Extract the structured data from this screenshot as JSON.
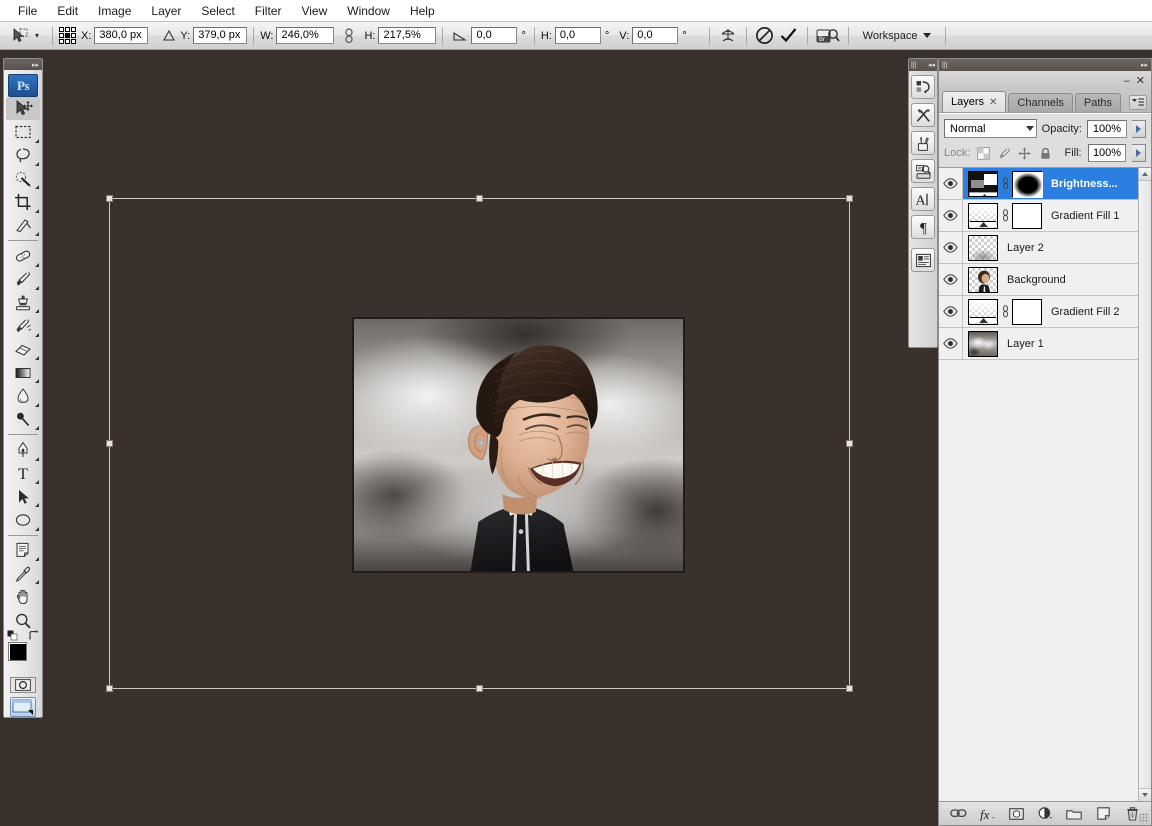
{
  "app": {
    "title": "Adobe Photoshop",
    "logo_text": "Ps"
  },
  "menubar": {
    "items": [
      {
        "label": "File"
      },
      {
        "label": "Edit"
      },
      {
        "label": "Image"
      },
      {
        "label": "Layer"
      },
      {
        "label": "Select"
      },
      {
        "label": "Filter"
      },
      {
        "label": "View"
      },
      {
        "label": "Window"
      },
      {
        "label": "Help"
      }
    ]
  },
  "options_bar": {
    "active_tool": "move-tool",
    "reference_point_label": "reference-point-grid",
    "fields": [
      {
        "name": "x",
        "label": "X:",
        "value": "380,0 px"
      },
      {
        "name": "y",
        "label": "Y:",
        "value": "379,0 px"
      },
      {
        "name": "width",
        "label": "W:",
        "value": "246,0%"
      },
      {
        "name": "height",
        "label": "H:",
        "value": "217,5%"
      },
      {
        "name": "rotate",
        "label": "",
        "value": "0,0",
        "unit": "°"
      },
      {
        "name": "skew_h",
        "label": "H:",
        "value": "0,0",
        "unit": "°"
      },
      {
        "name": "skew_v",
        "label": "V:",
        "value": "0,0",
        "unit": "°"
      }
    ],
    "link_tooltip": "Maintain aspect ratio",
    "buttons": [
      {
        "name": "warp-mode-button",
        "icon": "warp-icon"
      },
      {
        "name": "cancel-transform-button",
        "icon": "cancel-icon"
      },
      {
        "name": "commit-transform-button",
        "icon": "checkmark-icon"
      },
      {
        "name": "bridge-button",
        "icon": "bridge-icon"
      }
    ],
    "workspace": {
      "label": "Workspace",
      "icon": "chevron-down-icon"
    }
  },
  "toolbox": {
    "tools": [
      {
        "name": "move-tool",
        "icon": "move-arrow-icon",
        "selected": true,
        "has_flyout": false
      },
      {
        "name": "marquee-tool",
        "icon": "rectangular-marquee-icon",
        "has_flyout": true
      },
      {
        "name": "lasso-tool",
        "icon": "lasso-icon",
        "has_flyout": true
      },
      {
        "name": "quick-selection-tool",
        "icon": "quick-selection-icon",
        "has_flyout": true
      },
      {
        "name": "crop-tool",
        "icon": "crop-icon",
        "has_flyout": true
      },
      {
        "name": "slice-tool",
        "icon": "slice-knife-icon",
        "has_flyout": true
      },
      {
        "name": "healing-brush-tool",
        "icon": "bandage-icon",
        "has_flyout": true
      },
      {
        "name": "brush-tool",
        "icon": "paintbrush-icon",
        "has_flyout": true
      },
      {
        "name": "clone-stamp-tool",
        "icon": "clone-stamp-icon",
        "has_flyout": true
      },
      {
        "name": "history-brush-tool",
        "icon": "history-brush-icon",
        "has_flyout": true
      },
      {
        "name": "eraser-tool",
        "icon": "eraser-icon",
        "has_flyout": true
      },
      {
        "name": "gradient-tool",
        "icon": "gradient-icon",
        "has_flyout": true
      },
      {
        "name": "blur-tool",
        "icon": "waterdrop-icon",
        "has_flyout": true
      },
      {
        "name": "dodge-tool",
        "icon": "dodge-icon",
        "has_flyout": true
      },
      {
        "name": "pen-tool",
        "icon": "pen-nib-icon",
        "has_flyout": true
      },
      {
        "name": "type-tool",
        "icon": "text-t-icon",
        "has_flyout": true
      },
      {
        "name": "path-selection-tool",
        "icon": "path-arrow-icon",
        "has_flyout": true
      },
      {
        "name": "shape-tool",
        "icon": "ellipse-shape-icon",
        "has_flyout": true
      },
      {
        "name": "notes-tool",
        "icon": "notes-icon",
        "has_flyout": true
      },
      {
        "name": "eyedropper-tool",
        "icon": "eyedropper-icon",
        "has_flyout": true
      },
      {
        "name": "hand-tool",
        "icon": "hand-icon",
        "has_flyout": false
      },
      {
        "name": "zoom-tool",
        "icon": "magnifier-icon",
        "has_flyout": false
      }
    ],
    "color_swatches": {
      "foreground": "#000000",
      "background": "#ffffff",
      "swap_icon": "swap-colors-icon",
      "default_icon": "default-colors-icon"
    },
    "quick_mask": {
      "name": "quick-mask-button",
      "icon": "quick-mask-icon"
    },
    "screen_mode": {
      "name": "screen-mode-button",
      "icon": "screen-mode-icon"
    }
  },
  "dock_strip": {
    "buttons": [
      {
        "name": "history-panel-button",
        "icon": "history-icon"
      },
      {
        "name": "tool-presets-panel-button",
        "icon": "tools-crossed-icon"
      },
      {
        "name": "brushes-panel-button",
        "icon": "brush-jar-icon"
      },
      {
        "name": "clone-source-panel-button",
        "icon": "clone-source-icon"
      },
      {
        "name": "character-panel-button",
        "icon": "character-a-icon"
      },
      {
        "name": "paragraph-panel-button",
        "icon": "pilcrow-icon"
      },
      {
        "name": "layer-comps-panel-button",
        "icon": "layer-comps-icon"
      }
    ],
    "collapse_icon": "double-chevron-left-icon"
  },
  "layers_panel": {
    "expand_icon": "double-chevron-right-icon",
    "minimize_label": "–",
    "close_label": "✕",
    "menu_icon": "panel-menu-icon",
    "tabs": [
      {
        "name": "tab-layers",
        "label": "Layers",
        "active": true,
        "closable": true
      },
      {
        "name": "tab-channels",
        "label": "Channels",
        "active": false,
        "closable": false
      },
      {
        "name": "tab-paths",
        "label": "Paths",
        "active": false,
        "closable": false
      }
    ],
    "blend_mode": {
      "label": "Normal",
      "icon": "chevron-down-icon"
    },
    "opacity": {
      "label": "Opacity:",
      "value": "100%"
    },
    "fill": {
      "label": "Fill:",
      "value": "100%"
    },
    "lock": {
      "label": "Lock:",
      "items": [
        {
          "name": "lock-transparency-button",
          "icon": "checkerboard-icon"
        },
        {
          "name": "lock-image-pixels-button",
          "icon": "paintbrush-icon"
        },
        {
          "name": "lock-position-button",
          "icon": "move-cross-icon"
        },
        {
          "name": "lock-all-button",
          "icon": "padlock-icon"
        }
      ]
    },
    "layers": [
      {
        "name": "Brightness...",
        "selected": true,
        "visible": true,
        "kind": "adjustment",
        "has_mask": true,
        "linked": true
      },
      {
        "name": "Gradient Fill 1",
        "selected": false,
        "visible": true,
        "kind": "gradient-fill",
        "has_mask": true,
        "linked": true
      },
      {
        "name": "Layer 2",
        "selected": false,
        "visible": true,
        "kind": "pixel-transparent",
        "has_mask": false,
        "linked": false
      },
      {
        "name": "Background",
        "selected": false,
        "visible": true,
        "kind": "pixel-portrait",
        "has_mask": false,
        "linked": false
      },
      {
        "name": "Gradient Fill 2",
        "selected": false,
        "visible": true,
        "kind": "gradient-fill",
        "has_mask": true,
        "linked": true
      },
      {
        "name": "Layer 1",
        "selected": false,
        "visible": true,
        "kind": "pixel-smoke",
        "has_mask": false,
        "linked": false
      }
    ],
    "footer_buttons": [
      {
        "name": "link-layers-button",
        "icon": "chain-link-icon"
      },
      {
        "name": "layer-style-button",
        "icon": "fx-icon"
      },
      {
        "name": "add-layer-mask-button",
        "icon": "mask-circle-icon"
      },
      {
        "name": "new-adjustment-layer-button",
        "icon": "half-filled-circle-icon"
      },
      {
        "name": "new-group-button",
        "icon": "folder-icon"
      },
      {
        "name": "new-layer-button",
        "icon": "new-page-icon"
      },
      {
        "name": "delete-layer-button",
        "icon": "trash-icon"
      }
    ]
  },
  "canvas": {
    "background_color": "#3a312c",
    "transform": {
      "active": true,
      "handles": 8,
      "border_color": "#cfc6bf"
    },
    "artwork": {
      "name": "caricature-portrait",
      "description": "Caricature portrait of a smiling man with a large head, dark bowl haircut, wearing a dark jacket, against a smoky grey background"
    }
  }
}
